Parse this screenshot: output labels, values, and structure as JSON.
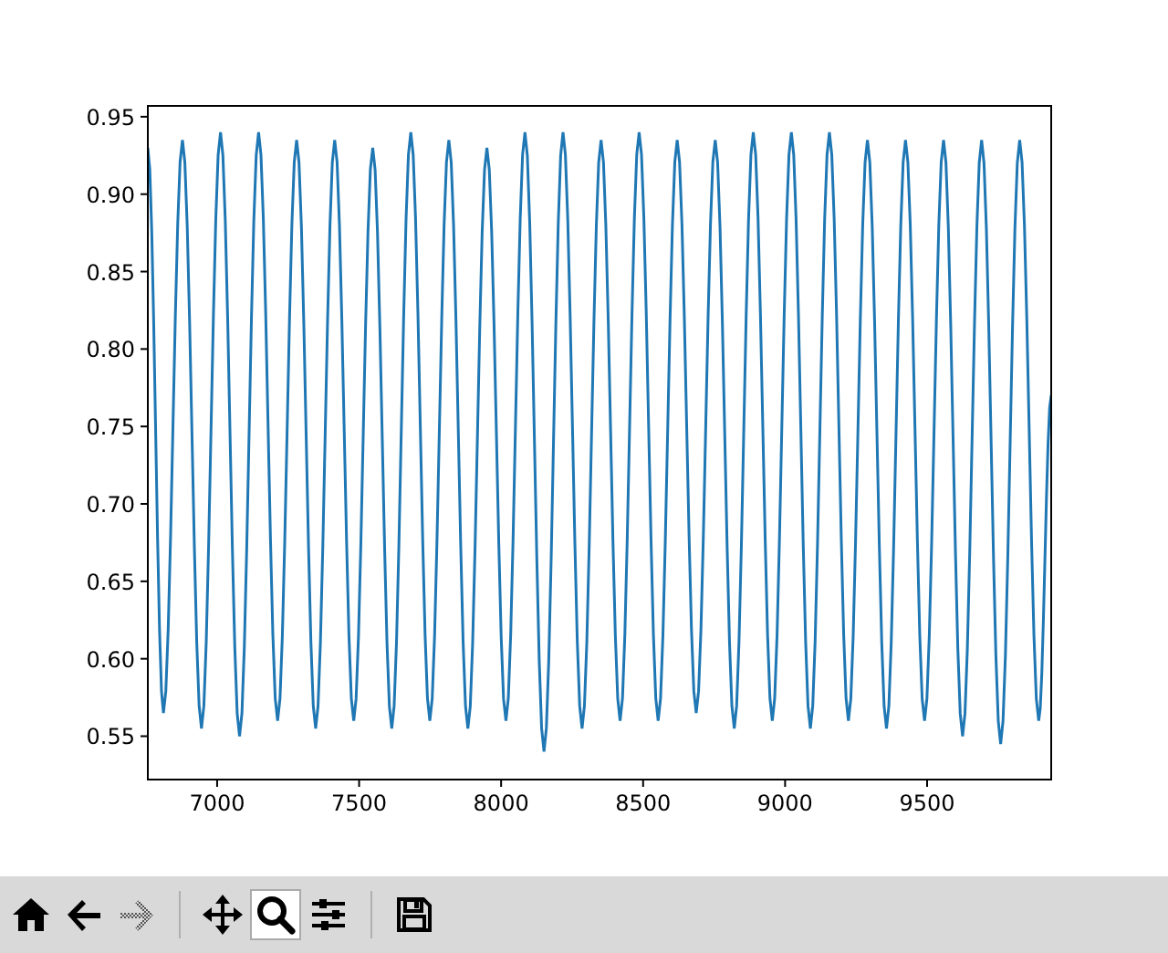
{
  "chart_data": {
    "type": "line",
    "xlim": [
      6756,
      9937
    ],
    "ylim": [
      0.522,
      0.957
    ],
    "xticks": [
      {
        "value": 7000,
        "label": "7000"
      },
      {
        "value": 7500,
        "label": "7500"
      },
      {
        "value": 8000,
        "label": "8000"
      },
      {
        "value": 8500,
        "label": "8500"
      },
      {
        "value": 9000,
        "label": "9000"
      },
      {
        "value": 9500,
        "label": "9500"
      }
    ],
    "yticks": [
      {
        "value": 0.55,
        "label": "0.55"
      },
      {
        "value": 0.6,
        "label": "0.60"
      },
      {
        "value": 0.65,
        "label": "0.65"
      },
      {
        "value": 0.7,
        "label": "0.70"
      },
      {
        "value": 0.75,
        "label": "0.75"
      },
      {
        "value": 0.8,
        "label": "0.80"
      },
      {
        "value": 0.85,
        "label": "0.85"
      },
      {
        "value": 0.9,
        "label": "0.90"
      },
      {
        "value": 0.95,
        "label": "0.95"
      }
    ],
    "x": [
      6756,
      6811,
      6878,
      6945,
      7012,
      7079,
      7146,
      7213,
      7280,
      7347,
      7414,
      7481,
      7548,
      7615,
      7682,
      7749,
      7816,
      7883,
      7950,
      8017,
      8084,
      8151,
      8218,
      8285,
      8352,
      8419,
      8486,
      8553,
      8620,
      8687,
      8754,
      8821,
      8888,
      8955,
      9022,
      9089,
      9156,
      9223,
      9290,
      9357,
      9424,
      9491,
      9558,
      9625,
      9692,
      9759,
      9826,
      9893,
      9937
    ],
    "series": [
      {
        "color": "#1f77b4",
        "values": [
          0.93,
          0.565,
          0.935,
          0.555,
          0.94,
          0.55,
          0.94,
          0.56,
          0.935,
          0.555,
          0.935,
          0.56,
          0.93,
          0.555,
          0.94,
          0.56,
          0.935,
          0.555,
          0.93,
          0.56,
          0.94,
          0.54,
          0.94,
          0.555,
          0.935,
          0.56,
          0.94,
          0.56,
          0.935,
          0.565,
          0.935,
          0.555,
          0.94,
          0.56,
          0.94,
          0.555,
          0.94,
          0.56,
          0.935,
          0.555,
          0.935,
          0.56,
          0.935,
          0.55,
          0.935,
          0.545,
          0.935,
          0.56,
          0.77
        ]
      }
    ]
  },
  "toolbar": [
    {
      "kind": "home",
      "disabled": false,
      "selected": false
    },
    {
      "kind": "back",
      "disabled": false,
      "selected": false
    },
    {
      "kind": "forward",
      "disabled": true,
      "selected": false
    },
    {
      "kind": "separator"
    },
    {
      "kind": "pan",
      "disabled": false,
      "selected": false
    },
    {
      "kind": "zoom",
      "disabled": false,
      "selected": true
    },
    {
      "kind": "subplots",
      "disabled": false,
      "selected": false
    },
    {
      "kind": "separator"
    },
    {
      "kind": "save",
      "disabled": false,
      "selected": false
    }
  ]
}
